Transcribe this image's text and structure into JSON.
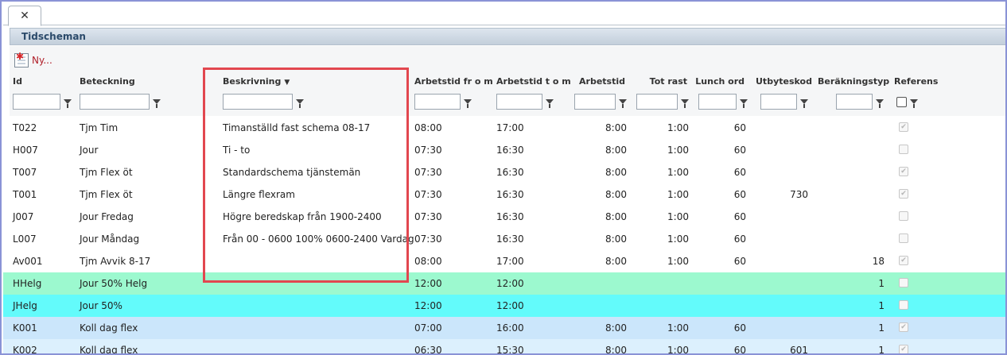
{
  "tab": {
    "close_label": "✕"
  },
  "panel": {
    "title": "Tidscheman"
  },
  "toolbar": {
    "new_label": "Ny..."
  },
  "columns": {
    "id": "Id",
    "beteckning": "Beteckning",
    "beskrivning": "Beskrivning",
    "fr": "Arbetstid fr o m",
    "tom": "Arbetstid t o m",
    "arbetstid": "Arbetstid",
    "rast": "Tot rast",
    "lunch": "Lunch ord",
    "utbyte": "Utbyteskod",
    "berakning": "Beräkningstyp",
    "referens": "Referens"
  },
  "sort": {
    "column": "beskrivning",
    "direction": "descending",
    "icon": "sort-down-icon"
  },
  "colors": {
    "highlight": "#e2474f",
    "green_row": "#9cf9cf",
    "cyan_row": "#63fbfb",
    "blue_row": "#cbe6fb"
  },
  "rows": [
    {
      "id": "T022",
      "beteckning": "Tjm Tim",
      "beskrivning": "Timanställd fast schema 08-17",
      "fr": "08:00",
      "tom": "17:00",
      "arbetstid": "8:00",
      "rast": "1:00",
      "lunch": "60",
      "utbyte": "",
      "berakning": "",
      "referens": true,
      "style": "alt0"
    },
    {
      "id": "H007",
      "beteckning": "Jour",
      "beskrivning": "Ti - to",
      "fr": "07:30",
      "tom": "16:30",
      "arbetstid": "8:00",
      "rast": "1:00",
      "lunch": "60",
      "utbyte": "",
      "berakning": "",
      "referens": false,
      "style": "alt0"
    },
    {
      "id": "T007",
      "beteckning": "Tjm Flex öt",
      "beskrivning": "Standardschema tjänstemän",
      "fr": "07:30",
      "tom": "16:30",
      "arbetstid": "8:00",
      "rast": "1:00",
      "lunch": "60",
      "utbyte": "",
      "berakning": "",
      "referens": true,
      "style": "alt0"
    },
    {
      "id": "T001",
      "beteckning": "Tjm Flex öt",
      "beskrivning": "Längre flexram",
      "fr": "07:30",
      "tom": "16:30",
      "arbetstid": "8:00",
      "rast": "1:00",
      "lunch": "60",
      "utbyte": "730",
      "berakning": "",
      "referens": true,
      "style": "alt0"
    },
    {
      "id": "J007",
      "beteckning": "Jour Fredag",
      "beskrivning": "Högre beredskap från 1900-2400",
      "fr": "07:30",
      "tom": "16:30",
      "arbetstid": "8:00",
      "rast": "1:00",
      "lunch": "60",
      "utbyte": "",
      "berakning": "",
      "referens": false,
      "style": "alt0"
    },
    {
      "id": "L007",
      "beteckning": "Jour Måndag",
      "beskrivning": "Från 00 - 0600 100% 0600-2400 Vardag",
      "fr": "07:30",
      "tom": "16:30",
      "arbetstid": "8:00",
      "rast": "1:00",
      "lunch": "60",
      "utbyte": "",
      "berakning": "",
      "referens": false,
      "style": "alt0"
    },
    {
      "id": "Av001",
      "beteckning": "Tjm Avvik 8-17",
      "beskrivning": "",
      "fr": "08:00",
      "tom": "17:00",
      "arbetstid": "8:00",
      "rast": "1:00",
      "lunch": "60",
      "utbyte": "",
      "berakning": "18",
      "referens": true,
      "style": "alt0"
    },
    {
      "id": "HHelg",
      "beteckning": "Jour 50% Helg",
      "beskrivning": "",
      "fr": "12:00",
      "tom": "12:00",
      "arbetstid": "",
      "rast": "",
      "lunch": "",
      "utbyte": "",
      "berakning": "1",
      "referens": false,
      "style": "green"
    },
    {
      "id": "JHelg",
      "beteckning": "Jour 50%",
      "beskrivning": "",
      "fr": "12:00",
      "tom": "12:00",
      "arbetstid": "",
      "rast": "",
      "lunch": "",
      "utbyte": "",
      "berakning": "1",
      "referens": false,
      "style": "cyan"
    },
    {
      "id": "K001",
      "beteckning": "Koll dag flex",
      "beskrivning": "",
      "fr": "07:00",
      "tom": "16:00",
      "arbetstid": "8:00",
      "rast": "1:00",
      "lunch": "60",
      "utbyte": "",
      "berakning": "1",
      "referens": true,
      "style": "blue1"
    },
    {
      "id": "K002",
      "beteckning": "Koll dag flex",
      "beskrivning": "",
      "fr": "06:30",
      "tom": "15:30",
      "arbetstid": "8:00",
      "rast": "1:00",
      "lunch": "60",
      "utbyte": "601",
      "berakning": "1",
      "referens": true,
      "style": "blue2"
    }
  ]
}
